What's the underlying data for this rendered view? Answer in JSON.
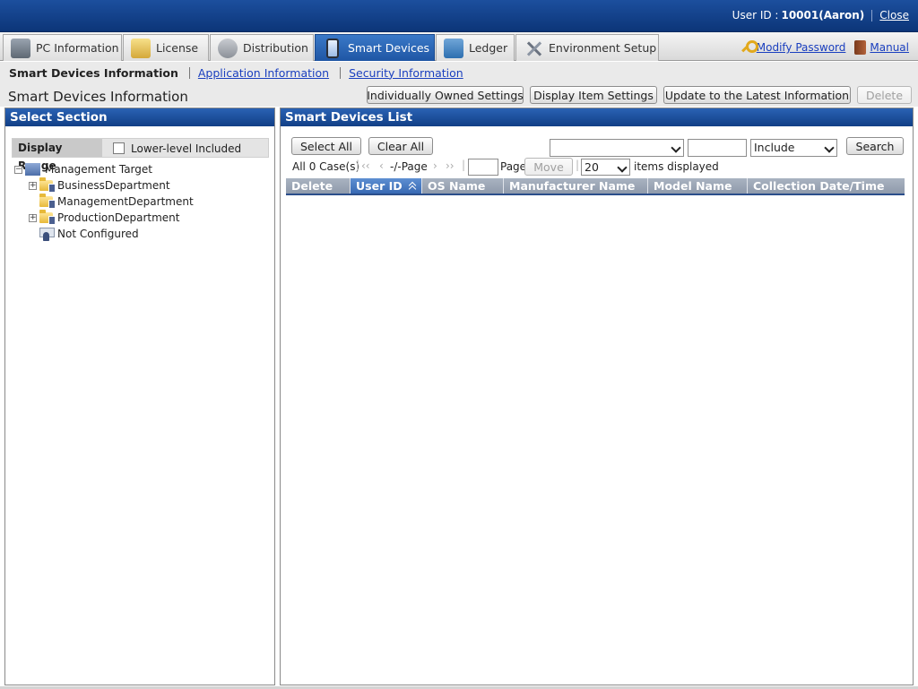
{
  "header": {
    "user_id_label": "User ID :",
    "user_id_value": "10001(Aaron)",
    "close_label": "Close"
  },
  "tabs": [
    {
      "label": "PC Information",
      "icon": "pc-icon"
    },
    {
      "label": "License",
      "icon": "license-icon"
    },
    {
      "label": "Distribution",
      "icon": "distribution-icon"
    },
    {
      "label": "Smart Devices",
      "icon": "smart-device-icon",
      "active": true
    },
    {
      "label": "Ledger",
      "icon": "ledger-icon"
    },
    {
      "label": "Environment Setup",
      "icon": "tools-icon"
    }
  ],
  "top_links": {
    "modify_password": "Modify Password",
    "manual": "Manual"
  },
  "subnav": {
    "current": "Smart Devices Information",
    "links": [
      "Application Information",
      "Security Information"
    ]
  },
  "page": {
    "title": "Smart Devices Information",
    "buttons": {
      "individually_owned": "Individually Owned Settings",
      "display_item": "Display Item Settings",
      "update_latest": "Update to the Latest Information",
      "delete": "Delete"
    }
  },
  "left_panel": {
    "title": "Select Section",
    "display_range_label": "Display Range",
    "lower_level_label": "Lower-level Included",
    "lower_level_checked": false,
    "tree": {
      "root": "Management Target",
      "children": [
        "BusinessDepartment",
        "ManagementDepartment",
        "ProductionDepartment",
        "Not Configured"
      ]
    }
  },
  "right_panel": {
    "title": "Smart Devices List",
    "select_all": "Select All",
    "clear_all": "Clear All",
    "filter_field_value": "",
    "filter_text_value": "",
    "filter_mode": "Include",
    "search": "Search",
    "count_text": "All 0 Case(s)",
    "page_text": "-/-Page",
    "page_input_value": "",
    "page_label": "Page",
    "move": "Move",
    "per_page": "20",
    "items_displayed": "items displayed",
    "columns": [
      "Delete",
      "User ID",
      "OS Name",
      "Manufacturer Name",
      "Model Name",
      "Collection Date/Time"
    ],
    "sorted_column": "User ID",
    "rows": []
  },
  "colors": {
    "header_blue": "#0c3578",
    "active_tab": "#1f56a4",
    "panel_head": "#113f86",
    "link": "#1a3fbf"
  }
}
